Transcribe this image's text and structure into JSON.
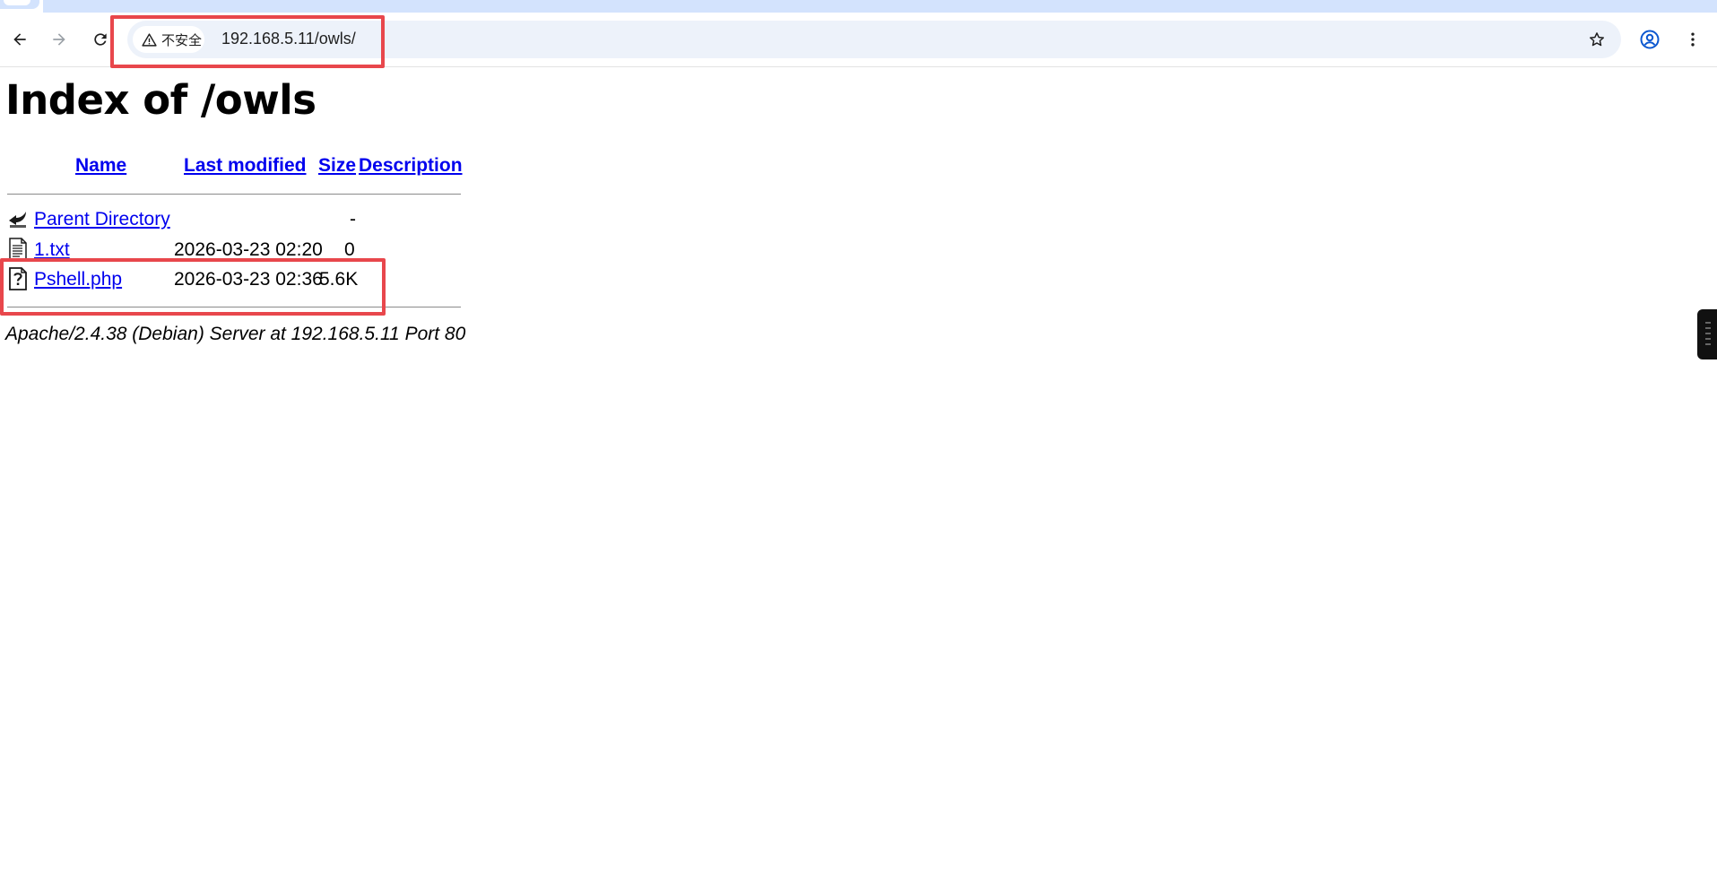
{
  "browser": {
    "security_label": "不安全",
    "url": "192.168.5.11/owls/",
    "icons": {
      "back": "back-arrow-icon",
      "forward": "forward-arrow-icon",
      "reload": "reload-icon",
      "warning": "warning-triangle-icon",
      "bookmark": "star-icon",
      "profile": "profile-icon",
      "menu": "kebab-menu-icon"
    }
  },
  "page": {
    "title": "Index of /owls",
    "columns": {
      "name": "Name",
      "last_modified": "Last modified",
      "size": "Size",
      "description": "Description"
    },
    "rows": [
      {
        "name": "Parent Directory",
        "last_modified": "",
        "size": "-",
        "description": "",
        "icon": "parent-directory-icon"
      },
      {
        "name": "1.txt",
        "last_modified": "2026-03-23 02:20",
        "size": "0",
        "description": "",
        "icon": "text-file-icon"
      },
      {
        "name": "Pshell.php",
        "last_modified": "2026-03-23 02:36",
        "size": "5.6K",
        "description": "",
        "icon": "unknown-file-icon"
      }
    ],
    "footer": "Apache/2.4.38 (Debian) Server at 192.168.5.11 Port 80"
  },
  "colors": {
    "link": "#0000ee",
    "highlight": "#e8474c",
    "omnibox_bg": "#edf2fa",
    "tabstrip_bg": "#d3e3fd"
  }
}
